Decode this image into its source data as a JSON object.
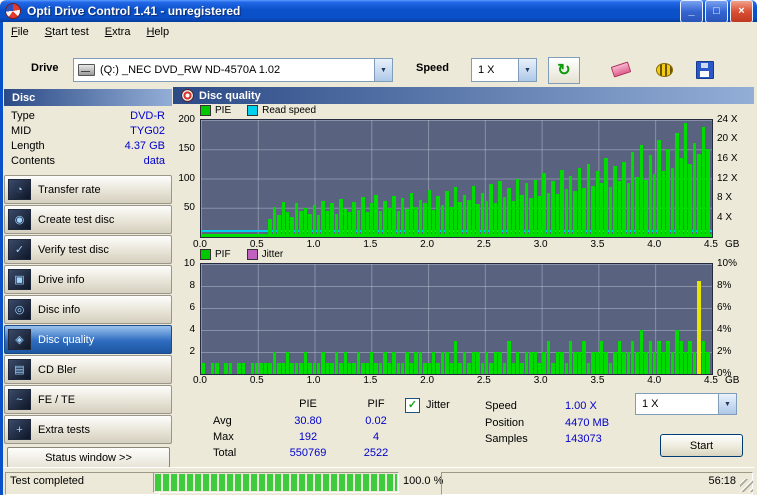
{
  "window": {
    "title": "Opti Drive Control 1.41 - unregistered",
    "controls": {
      "minimize": "_",
      "maximize": "□",
      "close": "×"
    }
  },
  "glyphs": {
    "dropdown": "▼",
    "check": "✓",
    "refresh": "↻"
  },
  "menu": [
    {
      "label": "File"
    },
    {
      "label": "Start test"
    },
    {
      "label": "Extra"
    },
    {
      "label": "Help"
    }
  ],
  "toolbar": {
    "drive_label": "Drive",
    "drive_value": "(Q:)  _NEC DVD_RW ND-4570A 1.02",
    "speed_label": "Speed",
    "speed_value": "1 X"
  },
  "sidebar": {
    "header": "Disc",
    "info": [
      {
        "label": "Type",
        "value": "DVD-R"
      },
      {
        "label": "MID",
        "value": "TYG02"
      },
      {
        "label": "Length",
        "value": "4.37 GB"
      },
      {
        "label": "Contents",
        "value": "data"
      }
    ],
    "buttons": [
      {
        "label": "Transfer rate",
        "icon": "transfer-rate-icon",
        "glyph": "◔",
        "selected": false
      },
      {
        "label": "Create test disc",
        "icon": "create-test-disc-icon",
        "glyph": "◉",
        "selected": false
      },
      {
        "label": "Verify test disc",
        "icon": "verify-test-disc-icon",
        "glyph": "✓",
        "selected": false
      },
      {
        "label": "Drive info",
        "icon": "drive-info-icon",
        "glyph": "▣",
        "selected": false
      },
      {
        "label": "Disc info",
        "icon": "disc-info-icon",
        "glyph": "◎",
        "selected": false
      },
      {
        "label": "Disc quality",
        "icon": "disc-quality-icon",
        "glyph": "◈",
        "selected": true
      },
      {
        "label": "CD Bler",
        "icon": "cd-bler-icon",
        "glyph": "▤",
        "selected": false
      },
      {
        "label": "FE / TE",
        "icon": "fe-te-icon",
        "glyph": "~",
        "selected": false
      },
      {
        "label": "Extra tests",
        "icon": "extra-tests-icon",
        "glyph": "+",
        "selected": false
      }
    ],
    "status_window_button": "Status window >>"
  },
  "main": {
    "header": "Disc quality"
  },
  "charts": {
    "top": {
      "legend": [
        {
          "label": "PIE",
          "color": "#00c800"
        },
        {
          "label": "Read speed",
          "color": "#00cfee"
        }
      ],
      "y_left": [
        "200",
        "150",
        "100",
        "50"
      ],
      "y_right": [
        "24 X",
        "20 X",
        "16 X",
        "12 X",
        "8 X",
        "4 X"
      ],
      "x_labels": [
        "0.0",
        "0.5",
        "1.0",
        "1.5",
        "2.0",
        "2.5",
        "3.0",
        "3.5",
        "4.0",
        "4.5"
      ],
      "x_unit": "GB",
      "y_max": 200,
      "bar_color": "#00dc00",
      "values": [
        3,
        2,
        4,
        3,
        2,
        3,
        4,
        3,
        2,
        3,
        4,
        2,
        3,
        3,
        5,
        30,
        52,
        38,
        60,
        42,
        35,
        58,
        44,
        50,
        40,
        55,
        38,
        62,
        45,
        58,
        40,
        65,
        48,
        42,
        60,
        46,
        68,
        42,
        58,
        72,
        45,
        62,
        50,
        70,
        44,
        66,
        48,
        75,
        52,
        64,
        58,
        80,
        46,
        70,
        55,
        78,
        52,
        85,
        60,
        72,
        64,
        88,
        56,
        76,
        62,
        90,
        58,
        95,
        68,
        84,
        62,
        100,
        72,
        92,
        66,
        98,
        70,
        110,
        76,
        96,
        74,
        115,
        82,
        104,
        78,
        118,
        84,
        125,
        88,
        112,
        92,
        135,
        86,
        122,
        96,
        128,
        92,
        145,
        102,
        158,
        98,
        140,
        108,
        165,
        112,
        150,
        118,
        178,
        135,
        195,
        125,
        160,
        142,
        188,
        150
      ]
    },
    "bottom": {
      "legend": [
        {
          "label": "PIF",
          "color": "#00c800"
        },
        {
          "label": "Jitter",
          "color": "#c060c0"
        }
      ],
      "y_left": [
        "10",
        "8",
        "6",
        "4",
        "2"
      ],
      "y_right": [
        "10%",
        "8%",
        "6%",
        "4%",
        "2%",
        "0%"
      ],
      "x_labels": [
        "0.0",
        "0.5",
        "1.0",
        "1.5",
        "2.0",
        "2.5",
        "3.0",
        "3.5",
        "4.0",
        "4.5"
      ],
      "x_unit": "GB",
      "y_max": 10,
      "bar_color": "#00dc00",
      "spike": {
        "index": 112,
        "value": 8.5,
        "color": "#e6e600"
      },
      "values": [
        1,
        0,
        1,
        1,
        0,
        1,
        1,
        0,
        1,
        1,
        0,
        1,
        1,
        1,
        1,
        1,
        2,
        1,
        1,
        2,
        1,
        1,
        1,
        2,
        1,
        1,
        1,
        2,
        1,
        1,
        2,
        1,
        2,
        1,
        1,
        2,
        1,
        1,
        2,
        1,
        1,
        2,
        1,
        2,
        1,
        1,
        2,
        1,
        2,
        2,
        1,
        1,
        2,
        1,
        2,
        2,
        1,
        3,
        1,
        2,
        1,
        2,
        2,
        1,
        2,
        1,
        2,
        2,
        1,
        3,
        1,
        2,
        1,
        2,
        2,
        2,
        1,
        2,
        3,
        1,
        2,
        2,
        1,
        3,
        2,
        2,
        3,
        1,
        2,
        2,
        3,
        2,
        1,
        2,
        3,
        2,
        2,
        3,
        2,
        4,
        2,
        3,
        2,
        3,
        2,
        3,
        2,
        4,
        3,
        2,
        3,
        2,
        2,
        3,
        2
      ]
    }
  },
  "stats": {
    "col_pie": "PIE",
    "col_pif": "PIF",
    "jitter_label": "Jitter",
    "jitter_checked": true,
    "rows": [
      {
        "label": "Avg",
        "pie": "30.80",
        "pif": "0.02"
      },
      {
        "label": "Max",
        "pie": "192",
        "pif": "4"
      },
      {
        "label": "Total",
        "pie": "550769",
        "pif": "2522"
      }
    ],
    "speed_label": "Speed",
    "speed_value": "1.00 X",
    "position_label": "Position",
    "position_value": "4470 MB",
    "samples_label": "Samples",
    "samples_value": "143073",
    "speed_select": "1 X",
    "start_button": "Start"
  },
  "statusbar": {
    "status": "Test completed",
    "progress": 100,
    "percent": "100.0 %",
    "time": "56:18"
  }
}
